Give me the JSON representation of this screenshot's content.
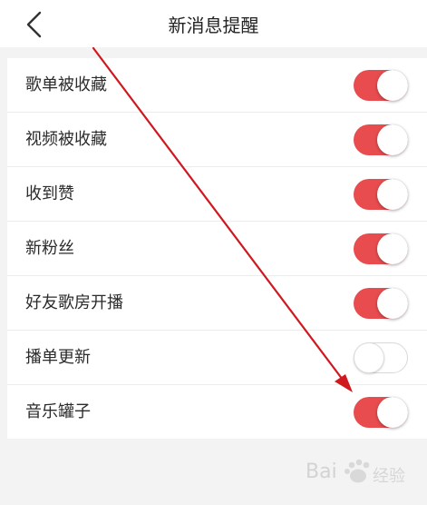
{
  "header": {
    "title": "新消息提醒",
    "back_icon": "chevron-left-icon"
  },
  "settings": [
    {
      "id": "playlist-favorited",
      "label": "歌单被收藏",
      "enabled": true
    },
    {
      "id": "video-favorited",
      "label": "视频被收藏",
      "enabled": true
    },
    {
      "id": "likes-received",
      "label": "收到赞",
      "enabled": true
    },
    {
      "id": "new-followers",
      "label": "新粉丝",
      "enabled": true
    },
    {
      "id": "friend-room-live",
      "label": "好友歌房开播",
      "enabled": true
    },
    {
      "id": "playlist-updates",
      "label": "播单更新",
      "enabled": false
    },
    {
      "id": "music-jar",
      "label": "音乐罐子",
      "enabled": true
    }
  ],
  "colors": {
    "toggle_on": "#e84c4e",
    "arrow": "#d0181f",
    "background": "#f3f3f3"
  },
  "watermark": {
    "label": "Bai经验",
    "icon": "baidu-paw-icon"
  }
}
